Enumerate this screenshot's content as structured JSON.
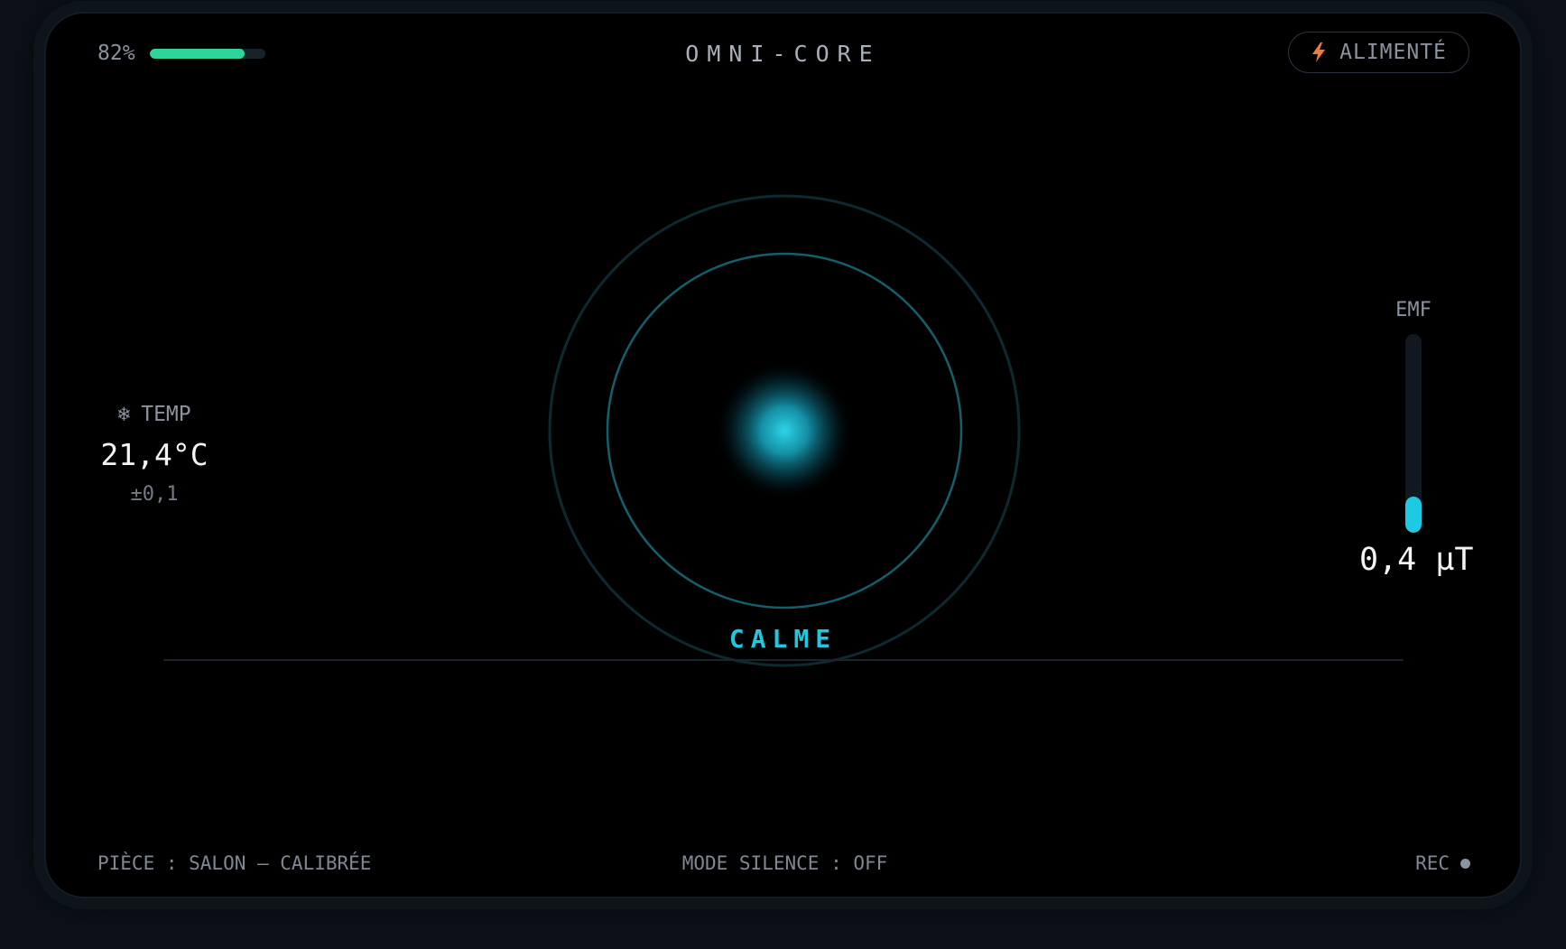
{
  "header": {
    "battery_percent_label": "82%",
    "battery_level": 0.82,
    "title": "OMNI-CORE",
    "power_status": "ALIMENTÉ",
    "power_icon": "lightning-bolt-icon"
  },
  "temperature": {
    "icon": "snowflake-icon",
    "label": "TEMP",
    "value": "21,4°C",
    "tolerance": "±0,1"
  },
  "emf": {
    "label": "EMF",
    "value": "0,4 µT",
    "level": 0.18
  },
  "radar": {
    "state": "CALME"
  },
  "footer": {
    "room_status": "PIÈCE : SALON — CALIBRÉE",
    "mode": "MODE SILENCE : OFF",
    "rec_label": "REC"
  },
  "colors": {
    "accent": "#22c6df",
    "battery": "#2ed39a",
    "power_icon": "#f07a3a",
    "background": "#000000"
  }
}
